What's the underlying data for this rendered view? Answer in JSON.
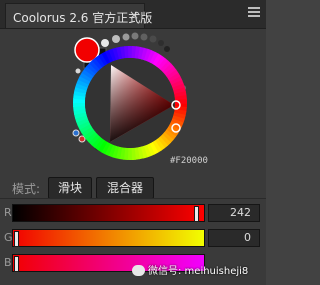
{
  "titlebar": {
    "tab_title": "Coolorus 2.6 官方正式版",
    "close_glyph": "×"
  },
  "colors": {
    "foreground": "#F20000",
    "background": "#111111",
    "accent": "#F20000"
  },
  "wheel": {
    "hex_readout": "#F20000"
  },
  "mode": {
    "label": "模式:",
    "slider_button": "滑块",
    "mixer_button": "混合器"
  },
  "sliders": {
    "r": {
      "label": "R",
      "value": "242",
      "level": 0.949
    },
    "g": {
      "label": "G",
      "value": "0",
      "level": 0
    },
    "b": {
      "label": "B",
      "value": "0",
      "level": 0
    }
  },
  "watermark": {
    "text": "微信号: meihuisheji8",
    "icon": "wechat-icon"
  }
}
